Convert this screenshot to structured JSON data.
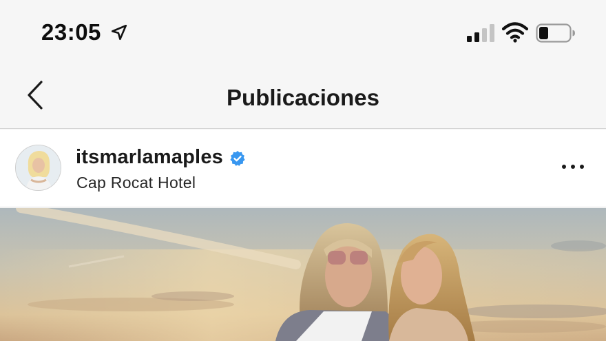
{
  "status_bar": {
    "time": "23:05",
    "icons": [
      "location-arrow-icon",
      "cellular-signal-icon",
      "wifi-icon",
      "battery-icon"
    ]
  },
  "nav": {
    "title": "Publicaciones",
    "back_icon": "chevron-left-icon"
  },
  "post": {
    "username": "itsmarlamaples",
    "verified": true,
    "location": "Cap Rocat Hotel",
    "more_icon": "more-options-icon"
  },
  "colors": {
    "verified_badge": "#3897f0",
    "background": "#f6f6f6",
    "text": "#1a1a1a"
  }
}
